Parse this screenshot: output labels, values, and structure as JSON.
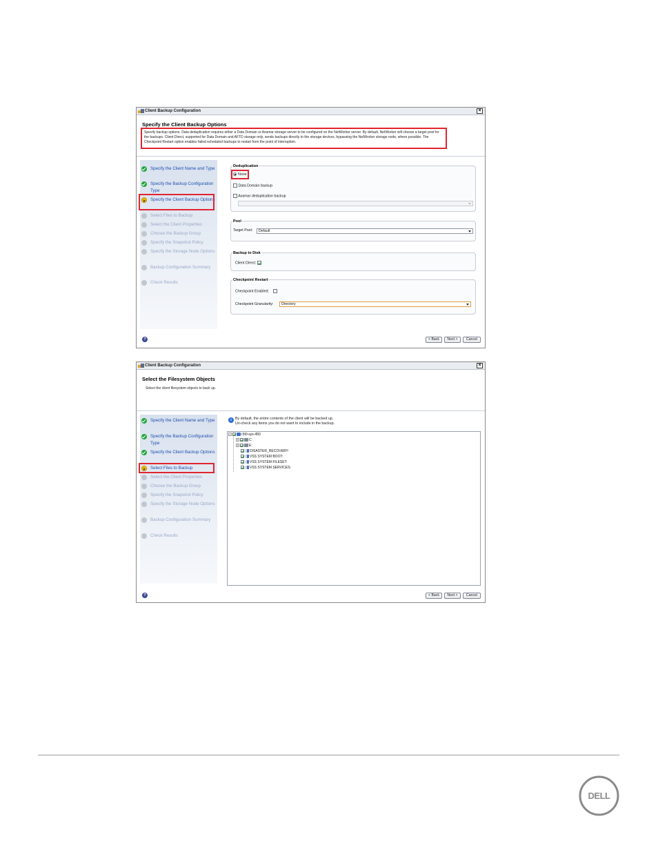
{
  "window_title": "Client Backup Configuration",
  "wizard_steps": [
    "Specify the Client Name and Type",
    "Specify the Backup Configuration Type",
    "Specify the Client Backup Options",
    "Select Files to Backup",
    "Select the Client Properties",
    "Choose the Backup Group",
    "Specify the Snapshot Policy",
    "Specify the Storage Node Options",
    "Backup Configuration Summary",
    "Check Results"
  ],
  "screen1": {
    "heading": "Specify the Client Backup Options",
    "description": "Specify backup options. Data deduplication requires either a Data Domain or Avamar storage server to be configured on the NetWorker server. By default, NetWorker will choose a target pool for the backups. Client Direct, supported for Data Domain and AFTD storage only, sends backups directly to the storage devices, bypassing the NetWorker storage node, where possible. The Checkpoint Restart option enables failed scheduled backups to restart from the point of interruption.",
    "deduplication": {
      "title": "Deduplication",
      "none_label": "None",
      "data_domain_label": "Data Domain backup",
      "avamar_label": "Avamar deduplication backup",
      "avamar_select_value": ""
    },
    "pool": {
      "title": "Pool",
      "target_pool_label": "Target Pool:",
      "target_pool_value": "Default"
    },
    "backup_to_disk": {
      "title": "Backup to Disk",
      "client_direct_label": "Client Direct:",
      "client_direct_checked": true
    },
    "checkpoint": {
      "title": "Checkpoint Restart",
      "enabled_label": "Checkpoint Enabled:",
      "enabled_checked": false,
      "granularity_label": "Checkpoint Granularity:",
      "granularity_value": "Directory"
    }
  },
  "screen2": {
    "heading": "Select the Filesystem Objects",
    "description": "Select the client filesystem objects to back up.",
    "info_line1": "By default, the entire contents of the client will be backed up.",
    "info_line2": "Un-check any items you do not want to include in the backup.",
    "tree": {
      "root": "r3t0-sys-450",
      "children": [
        "C:",
        "E:",
        "DISASTER_RECOVERY:",
        "VSS SYSTEM BOOT:",
        "VSS SYSTEM FILESET:",
        "VSS SYSTEM SERVICES:"
      ]
    }
  },
  "buttons": {
    "back": "< Back",
    "next": "Next >",
    "cancel": "Cancel",
    "help": "?"
  },
  "colors": {
    "highlight": "#e0242f",
    "step_done": "#22a53a",
    "step_current": "#f2c200",
    "step_todo": "#c2c7ce",
    "link_text": "#1f4fb0"
  },
  "logo_text": "DELL"
}
